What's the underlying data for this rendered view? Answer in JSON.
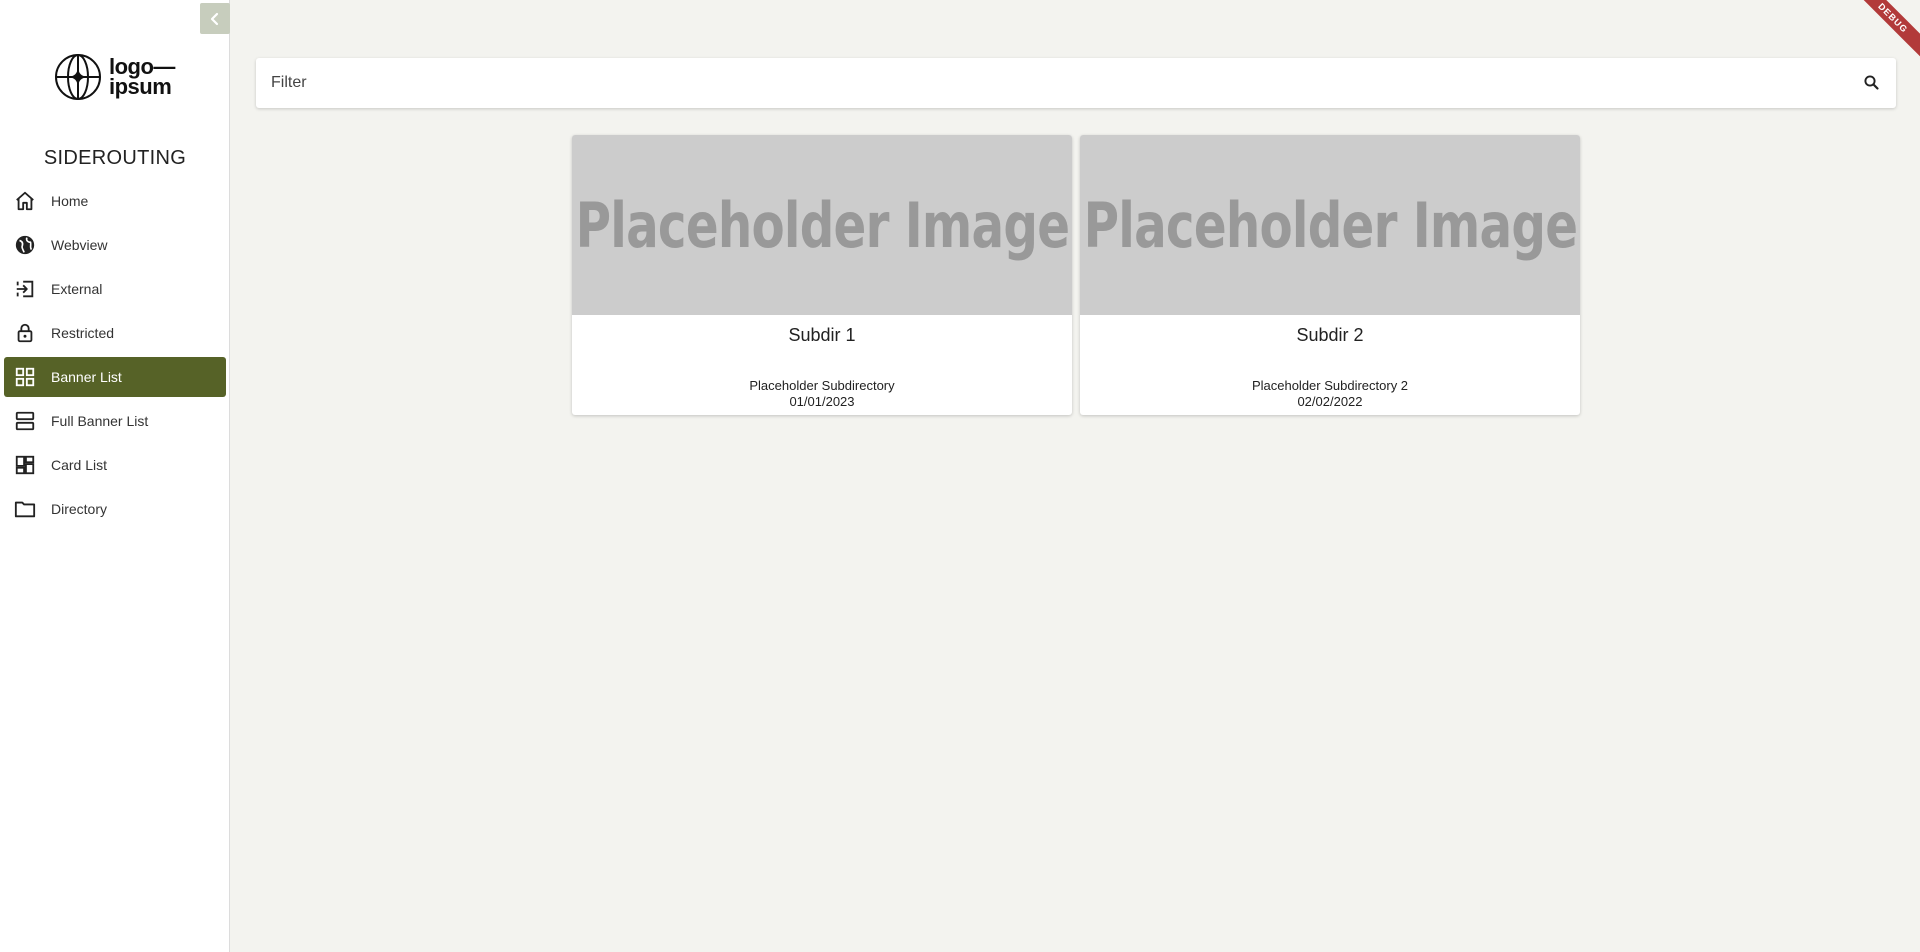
{
  "sidebar": {
    "logo": {
      "line1": "logo—",
      "line2": "ipsum"
    },
    "app_title": "SIDEROUTING",
    "items": [
      {
        "label": "Home",
        "icon": "home-icon"
      },
      {
        "label": "Webview",
        "icon": "globe-icon"
      },
      {
        "label": "External",
        "icon": "login-icon"
      },
      {
        "label": "Restricted",
        "icon": "lock-icon"
      },
      {
        "label": "Banner List",
        "icon": "grid-icon",
        "active": true
      },
      {
        "label": "Full Banner List",
        "icon": "rows-icon"
      },
      {
        "label": "Card List",
        "icon": "dashboard-icon"
      },
      {
        "label": "Directory",
        "icon": "folder-icon"
      }
    ]
  },
  "search": {
    "placeholder": "Filter",
    "value": ""
  },
  "cards": [
    {
      "image_text": "Placeholder Image",
      "title": "Subdir 1",
      "subtitle": "Placeholder Subdirectory",
      "date": "01/01/2023"
    },
    {
      "image_text": "Placeholder Image",
      "title": "Subdir 2",
      "subtitle": "Placeholder Subdirectory 2",
      "date": "02/02/2022"
    }
  ],
  "debug_banner": "DEBUG",
  "colors": {
    "accent": "#566227",
    "background": "#f3f3ef",
    "collapse_button": "#c7cdbd",
    "placeholder_bg": "#cccccc",
    "debug": "#b23a3a"
  }
}
